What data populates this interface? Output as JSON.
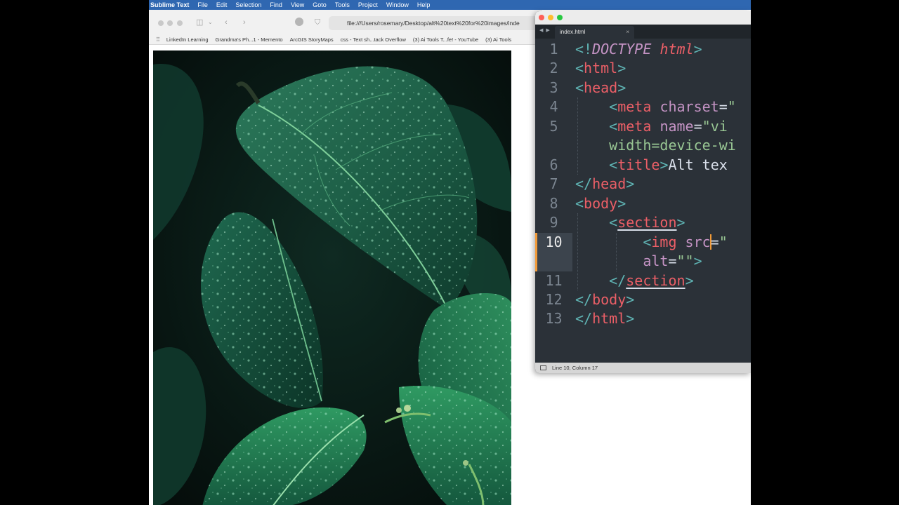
{
  "menubar": {
    "app": "Sublime Text",
    "items": [
      "File",
      "Edit",
      "Selection",
      "Find",
      "View",
      "Goto",
      "Tools",
      "Project",
      "Window",
      "Help"
    ]
  },
  "browser": {
    "url": "file:///Users/rosemary/Desktop/alt%20text%20for%20images/inde",
    "bookmarks": [
      "LinkedIn Learning",
      "Grandma's Ph...1 - Memento",
      "ArcGIS StoryMaps",
      "css - Text sh...tack Overflow",
      "(3) Ai Tools T...fe! - YouTube",
      "(3) Ai Tools"
    ]
  },
  "editor": {
    "tab": "index.html",
    "tab_close": "×",
    "nav_arrows": "◀ ▶",
    "line_numbers": [
      "1",
      "2",
      "3",
      "4",
      "5",
      "",
      "6",
      "7",
      "8",
      "9",
      "10",
      "",
      "11",
      "12",
      "13"
    ],
    "status": "Line 10, Column 17",
    "code": {
      "l1_open": "<!",
      "l1_doctype": "DOCTYPE",
      "l1_html": "html",
      "l1_close": ">",
      "lt": "<",
      "gt": ">",
      "lt_slash": "</",
      "html": "html",
      "head": "head",
      "meta": "meta",
      "charset": "charset",
      "eq": "=",
      "q": "\"",
      "name": "name",
      "name_val": "\"vi",
      "l5b": "width=device-wi",
      "title": "title",
      "title_text": "Alt tex",
      "body": "body",
      "section": "section",
      "img": "img",
      "src_before_caret": "src",
      "src_val": "\"",
      "alt": "alt",
      "alt_val": "\"\""
    }
  },
  "colors": {
    "menubar": "#2f67b1",
    "editor_bg": "#2b3138",
    "tag": "#ec5f67",
    "attr": "#c594c5",
    "string": "#99c794",
    "punct": "#5fb3b3",
    "caret": "#f29b38"
  },
  "image": {
    "subject": "leaf-photo"
  }
}
